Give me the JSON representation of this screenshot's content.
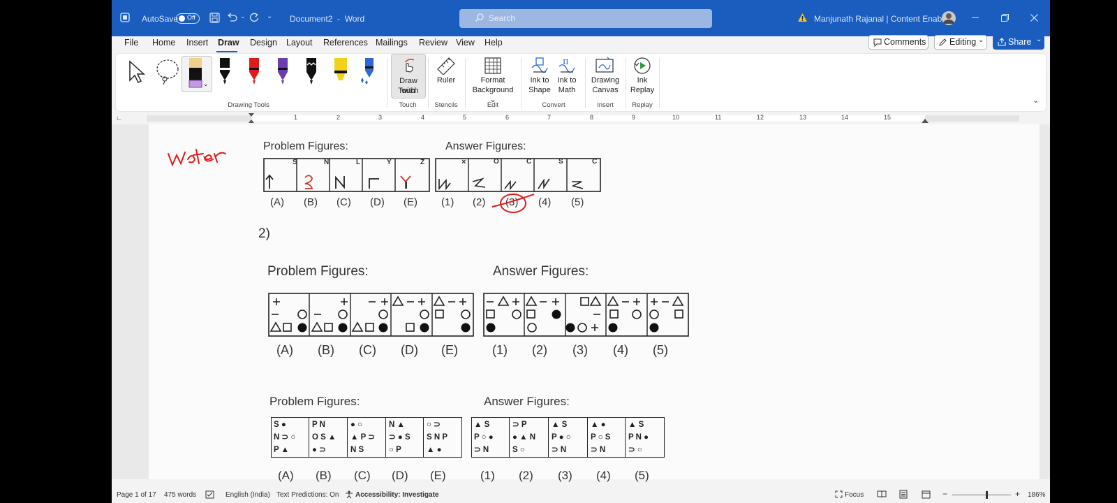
{
  "titlebar": {
    "autosave_label": "AutoSave",
    "autosave_state": "Off",
    "document_title": "Document2  -  Word",
    "search_placeholder": "Search",
    "user_name": "Manjunath Rajanal | Content Enablers"
  },
  "menu": {
    "tabs": [
      "File",
      "Home",
      "Insert",
      "Draw",
      "Design",
      "Layout",
      "References",
      "Mailings",
      "Review",
      "View",
      "Help"
    ],
    "active_tab": "Draw",
    "comments_label": "Comments",
    "editing_label": "Editing",
    "share_label": "Share"
  },
  "ribbon": {
    "groups": {
      "drawing_tools": "Drawing Tools",
      "touch": "Touch",
      "stencils": "Stencils",
      "edit": "Edit",
      "convert": "Convert",
      "insert": "Insert",
      "replay": "Replay"
    },
    "buttons": {
      "draw_with_touch_1": "Draw with",
      "draw_with_touch_2": "Touch",
      "ruler": "Ruler",
      "format_bg_1": "Format",
      "format_bg_2": "Background",
      "ink_shape_1": "Ink to",
      "ink_shape_2": "Shape",
      "ink_math_1": "Ink to",
      "ink_math_2": "Math",
      "drawing_canvas_1": "Drawing",
      "drawing_canvas_2": "Canvas",
      "ink_replay_1": "Ink",
      "ink_replay_2": "Replay"
    },
    "pen_colors": [
      "#111111",
      "#e01b1b",
      "#6a3db5",
      "#111111",
      "#f4d21a",
      "#2d6ad6"
    ]
  },
  "ruler": {
    "numbers": [
      "1",
      "2",
      "3",
      "4",
      "5",
      "6",
      "7",
      "8",
      "9",
      "10",
      "11",
      "12",
      "13",
      "14",
      "15"
    ]
  },
  "document": {
    "handwriting": "water",
    "q1": {
      "problem_title": "Problem Figures:",
      "answer_title": "Answer Figures:",
      "problem_labels": [
        "(A)",
        "(B)",
        "(C)",
        "(D)",
        "(E)"
      ],
      "answer_labels": [
        "(1)",
        "(2)",
        "(3)",
        "(4)",
        "(5)"
      ],
      "problem_corner": [
        "S",
        "N",
        "L",
        "Y",
        "Z"
      ],
      "answer_corner": [
        "×",
        "O",
        "C",
        "S",
        "C"
      ]
    },
    "q2_number": "2)",
    "q2": {
      "problem_title": "Problem Figures:",
      "answer_title": "Answer Figures:",
      "problem_labels": [
        "(A)",
        "(B)",
        "(C)",
        "(D)",
        "(E)"
      ],
      "answer_labels": [
        "(1)",
        "(2)",
        "(3)",
        "(4)",
        "(5)"
      ]
    },
    "q3": {
      "problem_title": "Problem Figures:",
      "answer_title": "Answer Figures:",
      "problem_labels": [
        "(A)",
        "(B)",
        "(C)",
        "(D)",
        "(E)"
      ],
      "answer_labels": [
        "(1)",
        "(2)",
        "(3)",
        "(4)",
        "(5)"
      ],
      "problem_rows": [
        [
          "S ●",
          "N ⊃ ○",
          "P ▲"
        ],
        [
          "P N",
          "O S ▲",
          "● ⊃"
        ],
        [
          "● ○",
          "▲ P ⊃",
          "N S"
        ],
        [
          "N ▲",
          "⊃ ● S",
          "○ P"
        ],
        [
          "○ ⊃",
          "S N P",
          "▲ ●"
        ]
      ],
      "answer_rows": [
        [
          "▲ S",
          "P ○ ●",
          "⊃ N"
        ],
        [
          "⊃ P",
          "● ▲ N",
          "S ○"
        ],
        [
          "▲ S",
          "P ● ○",
          "⊃ N"
        ],
        [
          "▲ ●",
          "P ○ S",
          "⊃ N"
        ],
        [
          "▲ S",
          "P N ●",
          "⊃ ○"
        ]
      ]
    }
  },
  "status": {
    "page": "Page 1 of 17",
    "words": "475 words",
    "language": "English (India)",
    "predictions": "Text Predictions: On",
    "accessibility": "Accessibility: Investigate",
    "focus": "Focus",
    "zoom": "186%"
  }
}
